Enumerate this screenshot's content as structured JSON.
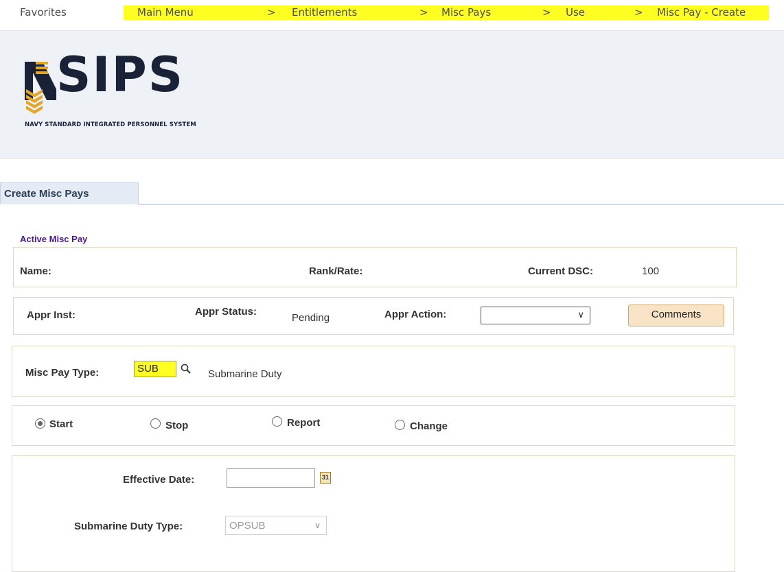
{
  "breadcrumb": {
    "favorites": "Favorites",
    "items": [
      "Main Menu",
      "Entitlements",
      "Misc Pays",
      "Use",
      "Misc Pay - Create"
    ],
    "separator": ">"
  },
  "logo": {
    "name": "NSIPS",
    "subtitle": "NAVY STANDARD INTEGRATED PERSONNEL SYSTEM"
  },
  "tab": {
    "label": "Create Misc Pays"
  },
  "section": {
    "title": "Active Misc Pay"
  },
  "member": {
    "name_label": "Name:",
    "rank_label": "Rank/Rate:",
    "dsc_label": "Current DSC:",
    "dsc_value": "100"
  },
  "approval": {
    "inst_label": "Appr Inst:",
    "status_label": "Appr Status:",
    "status_value": "Pending",
    "action_label": "Appr Action:",
    "action_value": "",
    "comments_button": "Comments"
  },
  "misc_pay": {
    "type_label": "Misc Pay Type:",
    "type_value": "SUB",
    "type_description": "Submarine Duty"
  },
  "actions": {
    "options": [
      "Start",
      "Stop",
      "Report",
      "Change"
    ],
    "selected": "Start"
  },
  "details": {
    "effective_date_label": "Effective Date:",
    "effective_date_value": "",
    "calendar_icon_text": "31",
    "duty_type_label": "Submarine Duty Type:",
    "duty_type_value": "OPSUB"
  },
  "colors": {
    "highlight": "#ffff22",
    "section_title": "#4a1a8a",
    "banner_bg": "#eef2f7",
    "button_bg": "#f9e3c6",
    "logo_gold": "#e3a82b",
    "logo_navy": "#1a2238"
  }
}
